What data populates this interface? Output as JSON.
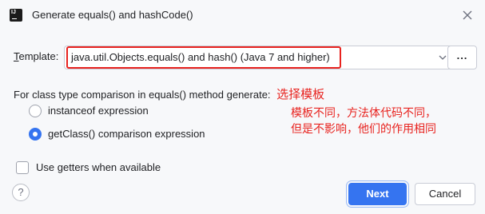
{
  "dialog": {
    "title": "Generate equals() and hashCode()",
    "close_icon": "close-icon",
    "app_icon": "intellij-idea-icon"
  },
  "template": {
    "label_mnemonic": "T",
    "label_rest": "emplate:",
    "value": "java.util.Objects.equals() and hash() (Java 7 and higher)",
    "more_label": "...",
    "annotation_color": "#e8231f"
  },
  "comparison": {
    "label": "For class type comparison in equals() method generate:",
    "options": [
      {
        "label": "instanceof expression",
        "selected": false
      },
      {
        "label": "getClass() comparison expression",
        "selected": true
      }
    ]
  },
  "getters": {
    "label": "Use getters when available",
    "checked": false
  },
  "buttons": {
    "help": "?",
    "next": "Next",
    "cancel": "Cancel"
  },
  "annotations": {
    "select_template": "选择模板",
    "note_line1": "模板不同，方法体代码不同，",
    "note_line2": "但是不影响，他们的作用相同"
  },
  "colors": {
    "accent": "#3574f0",
    "annotation": "#e8231f",
    "background": "#f7f8fa"
  }
}
